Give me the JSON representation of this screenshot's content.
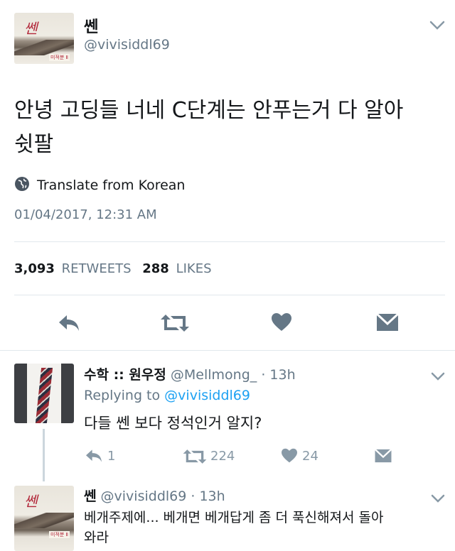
{
  "tweet": {
    "display_name": "쎈",
    "handle": "@vivisiddl69",
    "text_line1": "안녕 고딩들 너네 C단계는 안푸는거 다 알아",
    "text_line2": "쉿팔",
    "translate": "Translate from Korean",
    "timestamp": "01/04/2017, 12:31 AM",
    "retweets_count": "3,093",
    "retweets_label": "RETWEETS",
    "likes_count": "288",
    "likes_label": "LIKES",
    "avatar_text": "쎈",
    "avatar_pub": "미적분 Ⅱ"
  },
  "reply1": {
    "display_name": "수학 :: 원우정",
    "handle": "@Mellmong_",
    "time": "· 13h",
    "replying_label": "Replying to",
    "replying_handle": "@vivisiddl69",
    "text": "다들 쎈 보다 정석인거 알지?",
    "reply_count": "1",
    "retweet_count": "224",
    "like_count": "24"
  },
  "reply2": {
    "display_name": "쎈",
    "handle": "@vivisiddl69",
    "time": "· 13h",
    "text_line1": "베개주제에... 베개면 베개답게 좀 더 푹신해져서 돌아",
    "text_line2": "와라",
    "avatar_text": "쎈",
    "avatar_pub": "미적분 Ⅱ"
  },
  "colors": {
    "accent": "#1da1f2",
    "icon": "#657786",
    "muted_icon": "#8899a6"
  },
  "icons": [
    "globe-icon",
    "reply-icon",
    "retweet-icon",
    "heart-icon",
    "dm-icon",
    "chevron-down-icon"
  ]
}
